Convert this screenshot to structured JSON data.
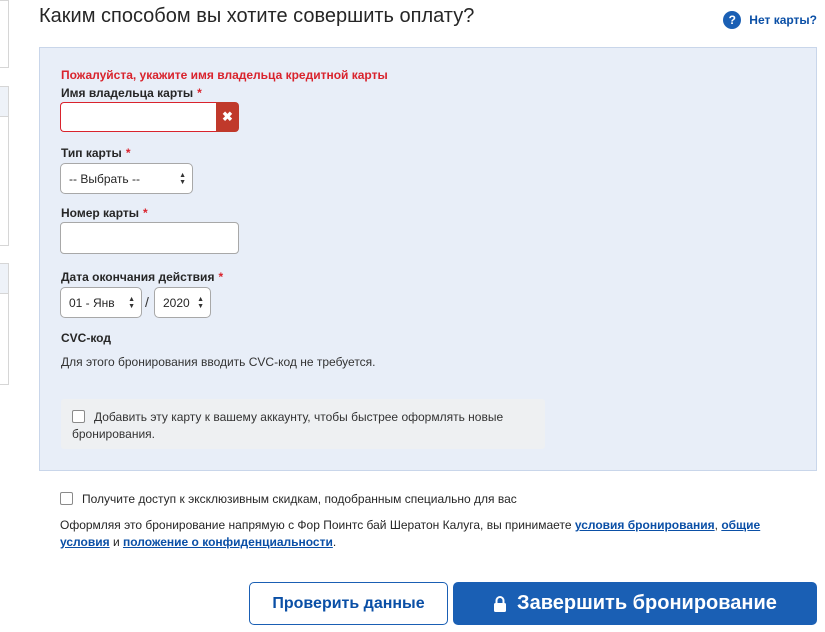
{
  "header": {
    "title": "Каким способом вы хотите совершить оплату?",
    "no_card": "Нет карты?"
  },
  "form": {
    "error": "Пожалуйста, укажите имя владельца кредитной карты",
    "required_mark": "*",
    "holder_label": "Имя владельца карты",
    "holder_value": "",
    "clear_glyph": "✖",
    "card_type_label": "Тип карты",
    "card_type_value": "-- Выбрать --",
    "card_number_label": "Номер карты",
    "card_number_value": "",
    "expiry_label": "Дата окончания действия",
    "expiry_month": "01 - Янв",
    "expiry_separator": "/",
    "expiry_year": "2020",
    "cvc_label": "CVC-код",
    "cvc_note": "Для этого бронирования вводить CVC-код не требуется.",
    "save_card": "Добавить эту карту к вашему аккаунту, чтобы быстрее оформлять новые бронирования."
  },
  "promo": {
    "text": "Получите доступ к эксклюзивным скидкам, подобранным специально для вас"
  },
  "legal": {
    "intro": "Оформляя это бронирование напрямую с Фор Поинтс бай Шератон Калуга, вы принимаете ",
    "terms_link": "условия бронирования",
    "comma": ", ",
    "general_link": "общие условия",
    "and": " и ",
    "privacy_link": "положение о конфиденциальности",
    "end": "."
  },
  "actions": {
    "check_label": "Проверить данные",
    "complete_label": "Завершить бронирование"
  },
  "colors": {
    "accent": "#1a5fb4",
    "error": "#d9232d",
    "panel": "#e8eef8"
  }
}
